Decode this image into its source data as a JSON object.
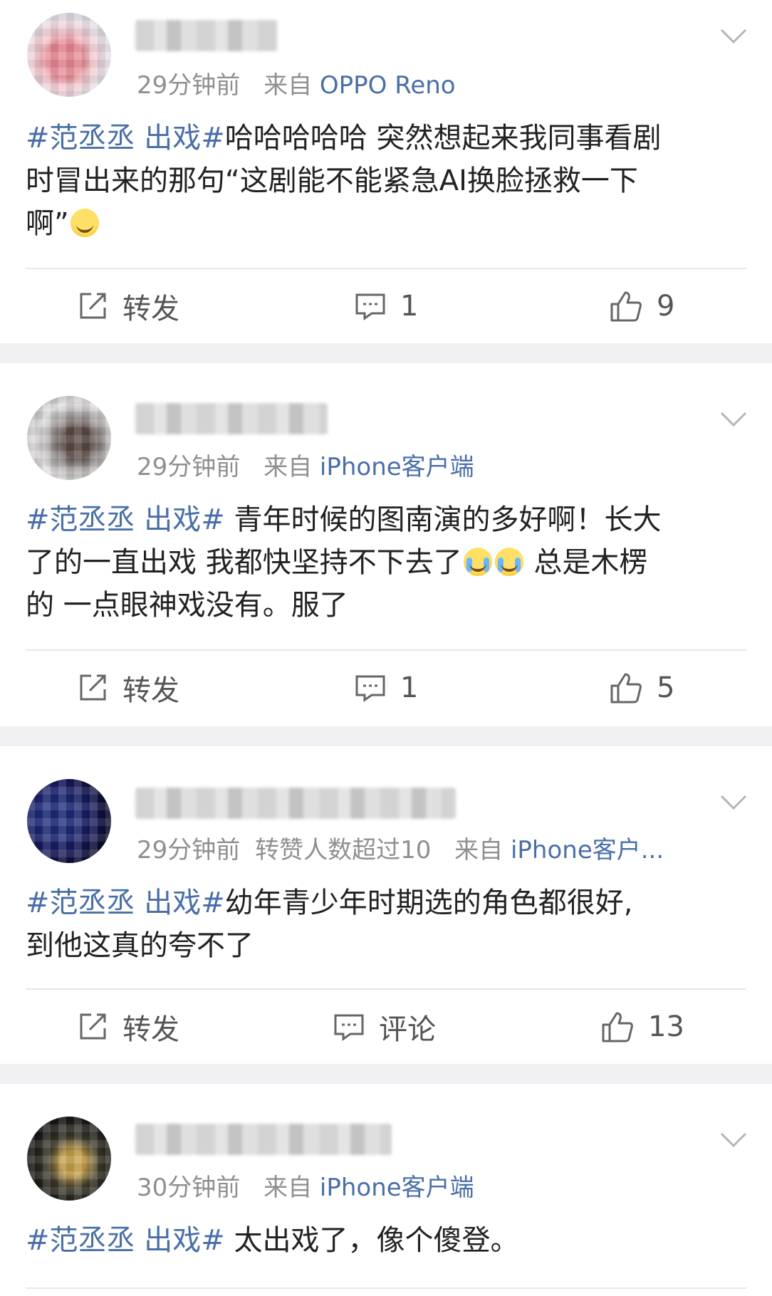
{
  "posts": [
    {
      "time": "29分钟前",
      "extra": "",
      "source_prefix": "来自",
      "source": "OPPO Reno",
      "tag": "#范丞丞 出戏#",
      "text_line1": "哈哈哈哈哈 突然想起来我同事看剧",
      "text_line2": "时冒出来的那句“这剧能不能紧急AI换脸拯救一下",
      "text_line3": "啊”",
      "repost_label": "转发",
      "comment_label": "1",
      "like_count": "9"
    },
    {
      "time": "29分钟前",
      "extra": "",
      "source_prefix": "来自",
      "source": "iPhone客户端",
      "tag": "#范丞丞 出戏#",
      "text_line1": " 青年时候的图南演的多好啊！长大",
      "text_line2a": "了的一直出戏 我都快坚持不下去了",
      "text_line2b": " 总是木楞",
      "text_line3": "的 一点眼神戏没有。服了",
      "repost_label": "转发",
      "comment_label": "1",
      "like_count": "5"
    },
    {
      "time": "29分钟前",
      "extra": "转赞人数超过10",
      "source_prefix": "来自",
      "source": "iPhone客户...",
      "tag": "#范丞丞 出戏#",
      "text_line1": "幼年青少年时期选的角色都很好,",
      "text_line2": "到他这真的夸不了",
      "repost_label": "转发",
      "comment_label": "评论",
      "like_count": "13"
    },
    {
      "time": "30分钟前",
      "extra": "",
      "source_prefix": "来自",
      "source": "iPhone客户端",
      "tag": "#范丞丞 出戏#",
      "text_line1": " 太出戏了，像个傻登。"
    }
  ],
  "icons": {
    "repost": "share-square-icon",
    "comment": "comment-bubble-icon",
    "like": "thumbs-up-icon",
    "more": "chevron-down-icon"
  },
  "colors": {
    "link": "#4a6fa8",
    "meta": "#8f8f8f",
    "background": "#f1f1f3"
  }
}
